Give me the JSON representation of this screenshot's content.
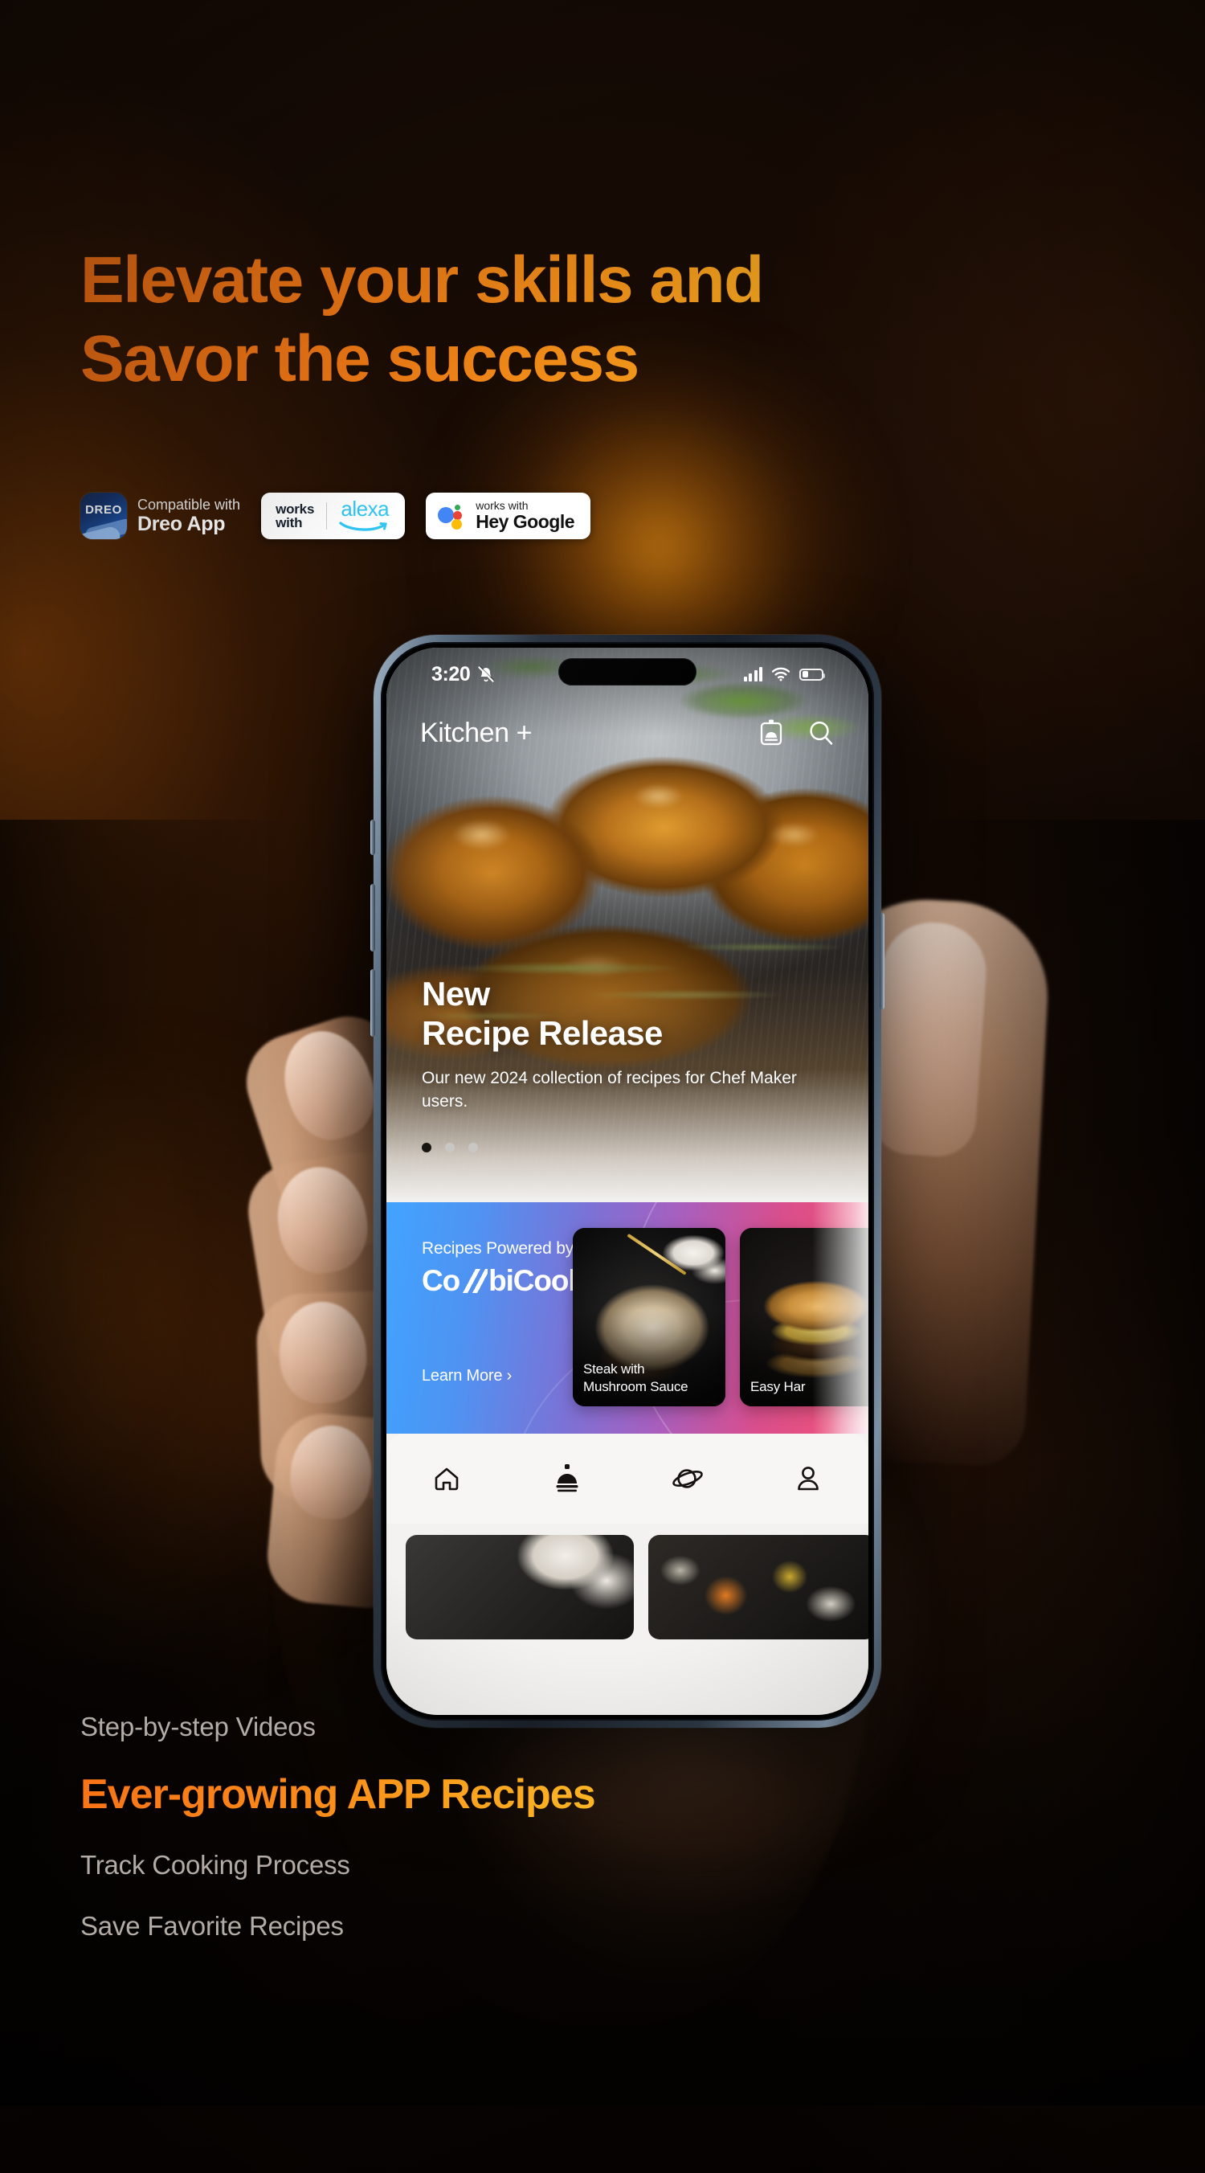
{
  "background": {
    "base_color": "#0a0503",
    "glow_color": "#FF9E16",
    "accent_orange": "#F97316",
    "accent_amber": "#FBB824"
  },
  "headline": {
    "line1": "Elevate your skills and",
    "line2": "Savor the success"
  },
  "badges": {
    "dreo": {
      "logo_text": "DREO",
      "caption": "Compatible with",
      "title": "Dreo App"
    },
    "alexa": {
      "works": "works",
      "with": "with",
      "brand": "alexa"
    },
    "google": {
      "caption": "works with",
      "brand": "Hey Google"
    }
  },
  "phone": {
    "status_bar": {
      "time": "3:20",
      "mute_icon": "bell-slash-icon",
      "signal_icon": "cellular-signal-icon",
      "wifi_icon": "wifi-icon",
      "battery_icon": "battery-icon",
      "battery_level": "34%"
    },
    "app_header": {
      "title": "Kitchen +",
      "appliance_icon": "cooker-icon",
      "search_icon": "search-icon"
    },
    "hero": {
      "title_line1": "New",
      "title_line2": "Recipe Release",
      "subtitle": "Our new 2024 collection of recipes for Chef Maker users.",
      "carousel": {
        "total": 3,
        "active_index": 0
      }
    },
    "combicook": {
      "kicker": "Recipes Powered by",
      "logo_before": "Co",
      "logo_after": "biCook",
      "learn_more": "Learn More ›",
      "cards": [
        {
          "title": "Steak with\nMushroom Sauce"
        },
        {
          "title": "Easy Har"
        }
      ]
    },
    "tabbar": {
      "items": [
        {
          "name": "home",
          "icon": "home-icon",
          "active": false
        },
        {
          "name": "recipes",
          "icon": "cooker-icon",
          "active": true
        },
        {
          "name": "explore",
          "icon": "planet-icon",
          "active": false
        },
        {
          "name": "profile",
          "icon": "person-icon",
          "active": false
        }
      ]
    }
  },
  "features": {
    "item1": "Step-by-step Videos",
    "highlight": "Ever-growing APP Recipes",
    "item2": "Track Cooking Process",
    "item3": "Save Favorite Recipes"
  }
}
